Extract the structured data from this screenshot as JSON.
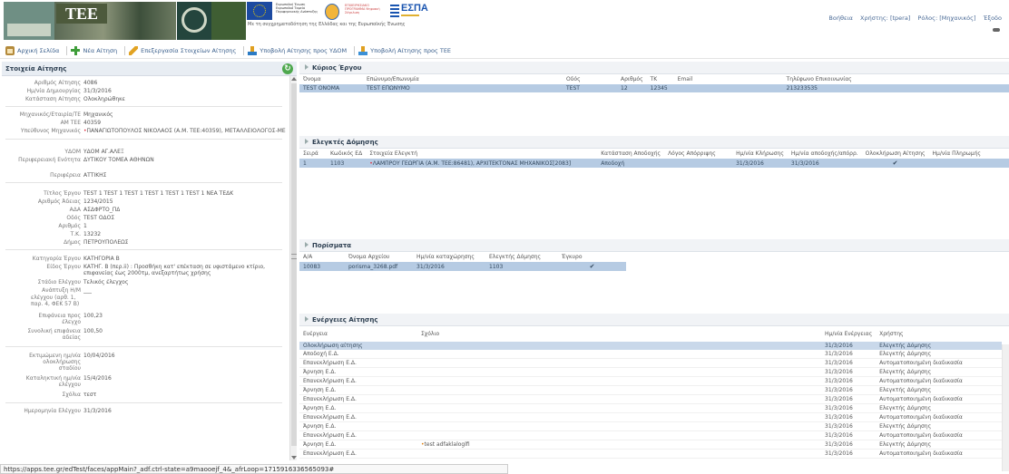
{
  "banner": {
    "tee_text": "TEE",
    "slogan": "Με τη συγχρηματοδότηση της Ελλάδας και της Ευρωπαϊκής Ένωσης",
    "espa_text": "ΕΣΠΑ",
    "eu_text": "Ευρωπαϊκή Ένωση Ευρωπαϊκό Ταμείο Περιφερειακής Ανάπτυξης",
    "nsrf_text": "ΕΠΙΧΕΙΡΗΣΙΑΚΟ ΠΡΟΓΡΑΜΜΑ Ψηφιακή Σύγκλιση"
  },
  "user_info": {
    "help": "Βοήθεια",
    "user": "Χρήστης: [tpera]",
    "role": "Ρόλος: [Μηχανικός]",
    "exit": "Έξοδο"
  },
  "toolbar": {
    "home": "Αρχική Σελίδα",
    "new_request": "Νέα Αίτηση",
    "edit_request": "Επεξεργασία Στοιχείων Αίτησης",
    "submit_yaom": "Υποβολή Αίτησης προς ΥΔΟΜ",
    "submit_tee": "Υποβολή Αίτησης προς ΤΕΕ"
  },
  "left_panel": {
    "title": "Στοιχεία Αίτησης",
    "fields": [
      {
        "label": "Αριθμός Αίτησης",
        "value": "4086"
      },
      {
        "label": "Ημ/νία Δημιουργίας",
        "value": "31/3/2016"
      },
      {
        "label": "Κατάσταση Αίτησης",
        "value": "Ολοκληρώθηκε"
      },
      {
        "label": "Μηχανικός/Εταιρία/ΤΕ",
        "value": "Μηχανικός"
      },
      {
        "label": "ΑΜ ΤΕΕ",
        "value": "40359"
      },
      {
        "label": "Υπεύθυνος Μηχανικός",
        "value": "ΠΑΝΑΓΙΩΤΟΠΟΥΛΟΣ ΝΙΚΟΛΑΟΣ (Α.Μ. ΤΕΕ:40359), ΜΕΤΑΛΛΕΙΟΛΟΓΟΣ-ΜΕ"
      },
      {
        "label": "ΥΔΟΜ",
        "value": "ΥΔΟΜ ΑΓ.ΑΛΕΞ"
      },
      {
        "label": "Περιφερειακή Ενότητα",
        "value": "ΔΥΤΙΚΟΥ ΤΟΜΕΑ ΑΘΗΝΩΝ"
      },
      {
        "label": "Περιφέρεια",
        "value": "ΑΤΤΙΚΗΣ"
      },
      {
        "label": "Τίτλος Έργου",
        "value": "TEST 1 TEST 1 TEST 1 TEST 1 TEST 1 TEST 1 ΝΕΑ ΤΕΔΚ"
      },
      {
        "label": "Αριθμός Άδειας",
        "value": "1234/2015"
      },
      {
        "label": "ΑΔΑ",
        "value": "ΑΣΔΦΡΤΟ_ΠΔ"
      },
      {
        "label": "Οδός",
        "value": "TEST ΟΔΟΣ"
      },
      {
        "label": "Αριθμός",
        "value": "1"
      },
      {
        "label": "Τ.Κ.",
        "value": "13232"
      },
      {
        "label": "Δήμος",
        "value": "ΠΕΤΡΟΥΠΟΛΕΩΣ"
      },
      {
        "label": "Κατηγορία Έργου",
        "value": "ΚΑΤΗΓΟΡΙΑ Β"
      },
      {
        "label": "Είδος Έργου",
        "value": "ΚΑΤΗΓ. Β (περ.ii) : Προσθήκη κατ' επέκταση σε υφιστάμενο κτίριο, επιφανείας έως 2000τμ, ανεξαρτήτως χρήσης"
      },
      {
        "label": "Στάδιο Ελέγχου",
        "value": "Τελικός έλεγχος"
      },
      {
        "label": "Ανάπτυξη Η/Μ",
        "value": "___"
      },
      {
        "label": "ελέγχου (αρθ. 1, παρ. 4, ΦΕΚ 57 Β)",
        "value": ""
      },
      {
        "label": "Επιφάνεια προς έλεγχο",
        "value": "100,23"
      },
      {
        "label": "Συνολική επιφάνεια αδείας",
        "value": "100,50"
      },
      {
        "label": "Εκτιμώμενη ημ/νία ολοκλήρωσης σταδίου",
        "value": "10/04/2016"
      },
      {
        "label": "Καταληκτική ημ/νία ελέγχου",
        "value": "15/4/2016"
      },
      {
        "label": "Σχόλια",
        "value": "τεστ"
      },
      {
        "label": "Ημερομηνία Ελέγχου",
        "value": "31/3/2016"
      }
    ]
  },
  "owner_section": {
    "title": "Κύριος Έργου",
    "columns": [
      "Όνομα",
      "Επώνυμο/Επωνυμία",
      "Οδός",
      "Αριθμός",
      "ΤΚ",
      "Email",
      "Τηλέφωνο Επικοινωνίας"
    ],
    "rows": [
      [
        "TEST ONOMA",
        "TEST ΕΠΩΝΥΜΟ",
        "TEST",
        "12",
        "12345",
        "",
        "213233535"
      ]
    ]
  },
  "inspectors_section": {
    "title": "Ελεγκτές Δόμησης",
    "columns": [
      "Σειρά",
      "Κωδικός ΕΔ",
      "Στοιχεία Ελεγκτή",
      "Κατάσταση Αποδοχής",
      "Λόγος Απόρριψης",
      "Ημ/νία Κλήρωσης",
      "Ημ/νία αποδοχής/απόρρ.",
      "Ολοκλήρωση Αίτησης",
      "Ημ/νία Πληρωμής"
    ],
    "rows": [
      [
        "1",
        "1103",
        "ΛΑΜΠΡΟΥ ΓΕΩΡΓΙΑ (Α.Μ. ΤΕΕ:86481), ΑΡΧΙΤΕΚΤΟΝΑΣ ΜΗΧΑΝΙΚΟΣ[2083]",
        "Αποδοχή",
        "",
        "31/3/2016",
        "31/3/2016",
        "✔",
        ""
      ]
    ]
  },
  "findings_section": {
    "title": "Πορίσματα",
    "columns": [
      "Α/Α",
      "Όνομα Αρχείου",
      "Ημ/νία καταχώρησης",
      "Ελεγκτής Δόμησης",
      "Έγκυρο"
    ],
    "rows": [
      [
        "10083",
        "porisma_3268.pdf",
        "31/3/2016",
        "1103",
        "✔"
      ]
    ]
  },
  "actions_section": {
    "title": "Ενέργειες Αίτησης",
    "columns": [
      "Ενέργεια",
      "Σχόλιο",
      "Ημ/νία Ενέργειας",
      "Χρήστης"
    ],
    "rows": [
      [
        "Ολοκλήρωση αίτησης",
        "",
        "31/3/2016",
        "Ελεγκτής Δόμησης"
      ],
      [
        "Αποδοχή Ε.Δ.",
        "",
        "31/3/2016",
        "Ελεγκτής Δόμησης"
      ],
      [
        "Επανεκλήρωση Ε.Δ.",
        "",
        "31/3/2016",
        "Αυτοματοποιημένη διαδικασία"
      ],
      [
        "Άρνηση Ε.Δ.",
        "",
        "31/3/2016",
        "Ελεγκτής Δόμησης"
      ],
      [
        "Επανεκλήρωση Ε.Δ.",
        "",
        "31/3/2016",
        "Αυτοματοποιημένη διαδικασία"
      ],
      [
        "Άρνηση Ε.Δ.",
        "",
        "31/3/2016",
        "Ελεγκτής Δόμησης"
      ],
      [
        "Επανεκλήρωση Ε.Δ.",
        "",
        "31/3/2016",
        "Αυτοματοποιημένη διαδικασία"
      ],
      [
        "Άρνηση Ε.Δ.",
        "",
        "31/3/2016",
        "Ελεγκτής Δόμησης"
      ],
      [
        "Επανεκλήρωση Ε.Δ.",
        "",
        "31/3/2016",
        "Αυτοματοποιημένη διαδικασία"
      ],
      [
        "Άρνηση Ε.Δ.",
        "",
        "31/3/2016",
        "Ελεγκτής Δόμησης"
      ],
      [
        "Επανεκλήρωση Ε.Δ.",
        "",
        "31/3/2016",
        "Αυτοματοποιημένη διαδικασία"
      ],
      [
        "Άρνηση Ε.Δ.",
        "test adfaklaloglfi",
        "31/3/2016",
        "Ελεγκτής Δόμησης"
      ],
      [
        "Επανεκλήρωση Ε.Δ.",
        "",
        "31/3/2016",
        "Αυτοματοποιημένη διαδικασία"
      ]
    ]
  },
  "status_url": "https://apps.tee.gr/edTest/faces/appMain?_adf.ctrl-state=a9maooejf_4&_afrLoop=1715916336565093#"
}
